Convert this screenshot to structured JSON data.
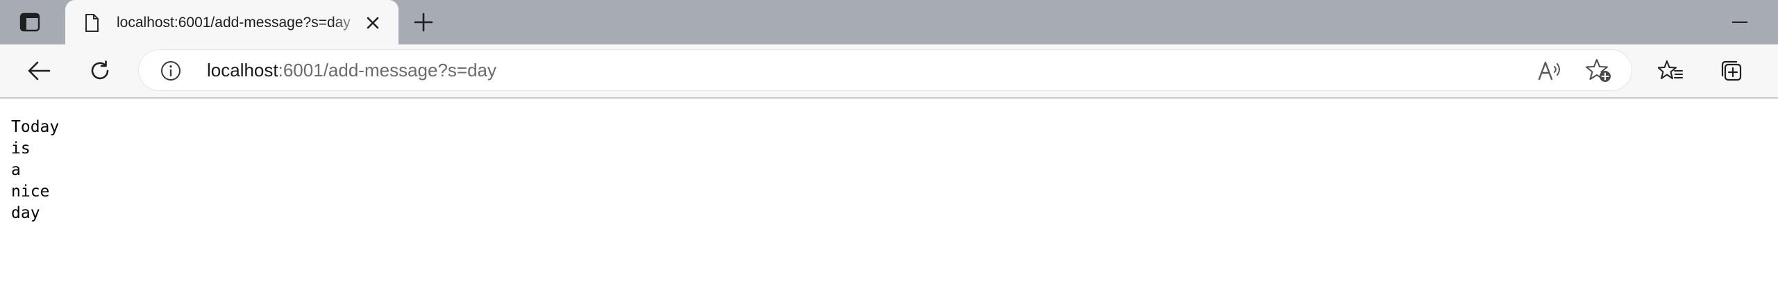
{
  "tab": {
    "title": "localhost:6001/add-message?s=day",
    "favicon": "document-icon"
  },
  "tabstrip": {
    "actions_icon": "tab-actions-icon",
    "close_icon": "close-icon",
    "new_tab_icon": "plus-icon",
    "minimize_icon": "minimize-icon"
  },
  "toolbar": {
    "back_icon": "back-arrow-icon",
    "refresh_icon": "refresh-icon",
    "info_icon": "info-icon",
    "read_aloud_icon": "read-aloud-icon",
    "add_favorite_icon": "add-favorite-icon",
    "favorites_icon": "favorites-icon",
    "collections_icon": "collections-icon"
  },
  "address": {
    "host": "localhost",
    "rest": ":6001/add-message?s=day"
  },
  "page": {
    "lines": [
      "Today",
      "is",
      "a",
      "nice",
      "day"
    ]
  },
  "colors": {
    "tabstrip_bg": "#a7abb3",
    "toolbar_bg": "#f7f7f7",
    "page_bg": "#ffffff"
  }
}
